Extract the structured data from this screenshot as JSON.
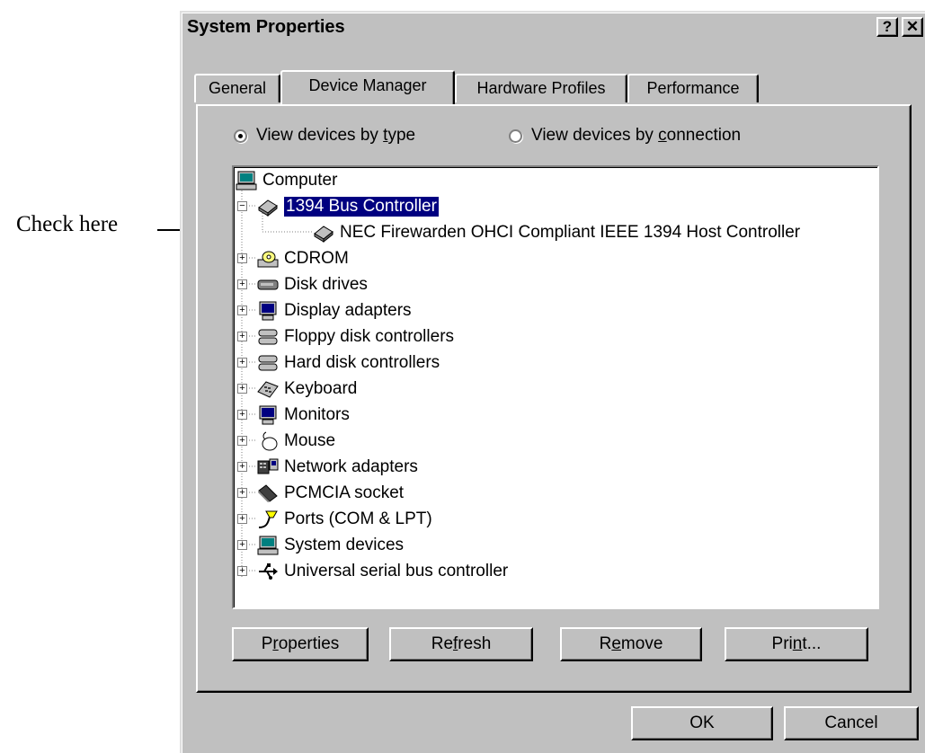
{
  "annotation": {
    "label": "Check here"
  },
  "window": {
    "title": "System Properties",
    "help_label": "?",
    "close_label": "✕"
  },
  "tabs": [
    {
      "label": "General",
      "active": false
    },
    {
      "label": "Device Manager",
      "active": true
    },
    {
      "label": "Hardware Profiles",
      "active": false
    },
    {
      "label": "Performance",
      "active": false
    }
  ],
  "view_options": {
    "by_type": {
      "pre": "View devices by ",
      "key": "t",
      "post": "ype",
      "checked": true
    },
    "by_connection": {
      "pre": "View devices by ",
      "key": "c",
      "post": "onnection",
      "checked": false
    }
  },
  "tree": {
    "root": {
      "label": "Computer",
      "icon": "computer-icon"
    },
    "items": [
      {
        "label": "1394 Bus Controller",
        "icon": "controller-card-icon",
        "expander": "−",
        "selected": true,
        "children": [
          {
            "label": "NEC Firewarden OHCI Compliant IEEE 1394 Host Controller",
            "icon": "controller-card-icon"
          }
        ]
      },
      {
        "label": "CDROM",
        "icon": "cdrom-icon",
        "expander": "+"
      },
      {
        "label": "Disk drives",
        "icon": "disk-drive-icon",
        "expander": "+"
      },
      {
        "label": "Display adapters",
        "icon": "display-adapter-icon",
        "expander": "+"
      },
      {
        "label": "Floppy disk controllers",
        "icon": "floppy-controller-icon",
        "expander": "+"
      },
      {
        "label": "Hard disk controllers",
        "icon": "hard-disk-controller-icon",
        "expander": "+"
      },
      {
        "label": "Keyboard",
        "icon": "keyboard-icon",
        "expander": "+"
      },
      {
        "label": "Monitors",
        "icon": "monitor-icon",
        "expander": "+"
      },
      {
        "label": "Mouse",
        "icon": "mouse-icon",
        "expander": "+"
      },
      {
        "label": "Network adapters",
        "icon": "network-adapter-icon",
        "expander": "+"
      },
      {
        "label": "PCMCIA socket",
        "icon": "pcmcia-icon",
        "expander": "+"
      },
      {
        "label": "Ports (COM & LPT)",
        "icon": "port-icon",
        "expander": "+"
      },
      {
        "label": "System devices",
        "icon": "system-device-icon",
        "expander": "+"
      },
      {
        "label": "Universal serial bus controller",
        "icon": "usb-icon",
        "expander": "+"
      }
    ]
  },
  "buttons": {
    "properties": {
      "pre": "P",
      "key": "r",
      "post": "operties"
    },
    "refresh": {
      "pre": "Re",
      "key": "f",
      "post": "resh"
    },
    "remove": {
      "pre": "R",
      "key": "e",
      "post": "move"
    },
    "print": {
      "pre": "Pri",
      "key": "n",
      "post": "t..."
    },
    "ok": "OK",
    "cancel": "Cancel"
  },
  "colors": {
    "selection": "#000080",
    "face": "#c0c0c0"
  }
}
